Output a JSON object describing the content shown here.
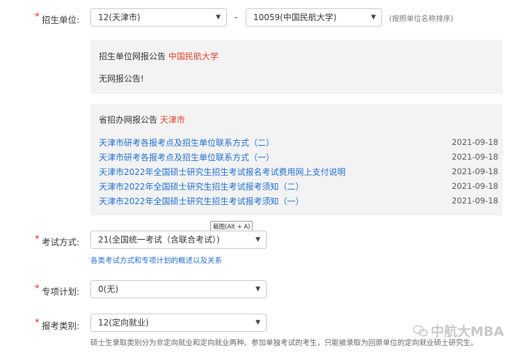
{
  "unit_row": {
    "required_mark": "*",
    "label": "招生单位:",
    "province_select": "12(天津市)",
    "dash": "-",
    "school_select": "10059(中国民航大学)",
    "hint": "(按照单位名称排序)"
  },
  "school_notice": {
    "title_prefix": "招生单位网报公告",
    "title_name": "中国民航大学",
    "content": "无网报公告!"
  },
  "province_notice": {
    "title_prefix": "省招办网报公告",
    "title_name": "天津市",
    "items": [
      {
        "title": "天津市研考各报考点及招生单位联系方式（二）",
        "date": "2021-09-18"
      },
      {
        "title": "天津市研考各报考点及招生单位联系方式（一）",
        "date": "2021-09-18"
      },
      {
        "title": "天津市2022年全国硕士研究生招生考试报名考试费用网上支付说明",
        "date": "2021-09-18"
      },
      {
        "title": "天津市2022年全国硕士研究生招生考试报考须知（二）",
        "date": "2021-09-18"
      },
      {
        "title": "天津市2022年全国硕士研究生招生考试报考须知（一）",
        "date": "2021-09-18"
      }
    ]
  },
  "tooltip": "截图(Alt + A)",
  "exam_mode": {
    "required_mark": "*",
    "label": "考试方式:",
    "value": "21(全国统一考试（含联合考试）)",
    "link": "各类考试方式和专项计划的概述以及关系"
  },
  "special_plan": {
    "required_mark": "*",
    "label": "专项计划:",
    "value": "0(无)"
  },
  "apply_type": {
    "required_mark": "*",
    "label": "报考类别:",
    "value": "12(定向就业)",
    "note": "硕士生录取类别分为非定向就业和定向就业两种。参加单独考试的考生，只能被录取为回原单位的定向就业硕士研究生。"
  },
  "watermark": "中航大MBA",
  "colors": {
    "required": "#e02020",
    "link": "#1f6fd0",
    "panel_bg": "#f3f3f3",
    "highlight": "#e0402a"
  }
}
